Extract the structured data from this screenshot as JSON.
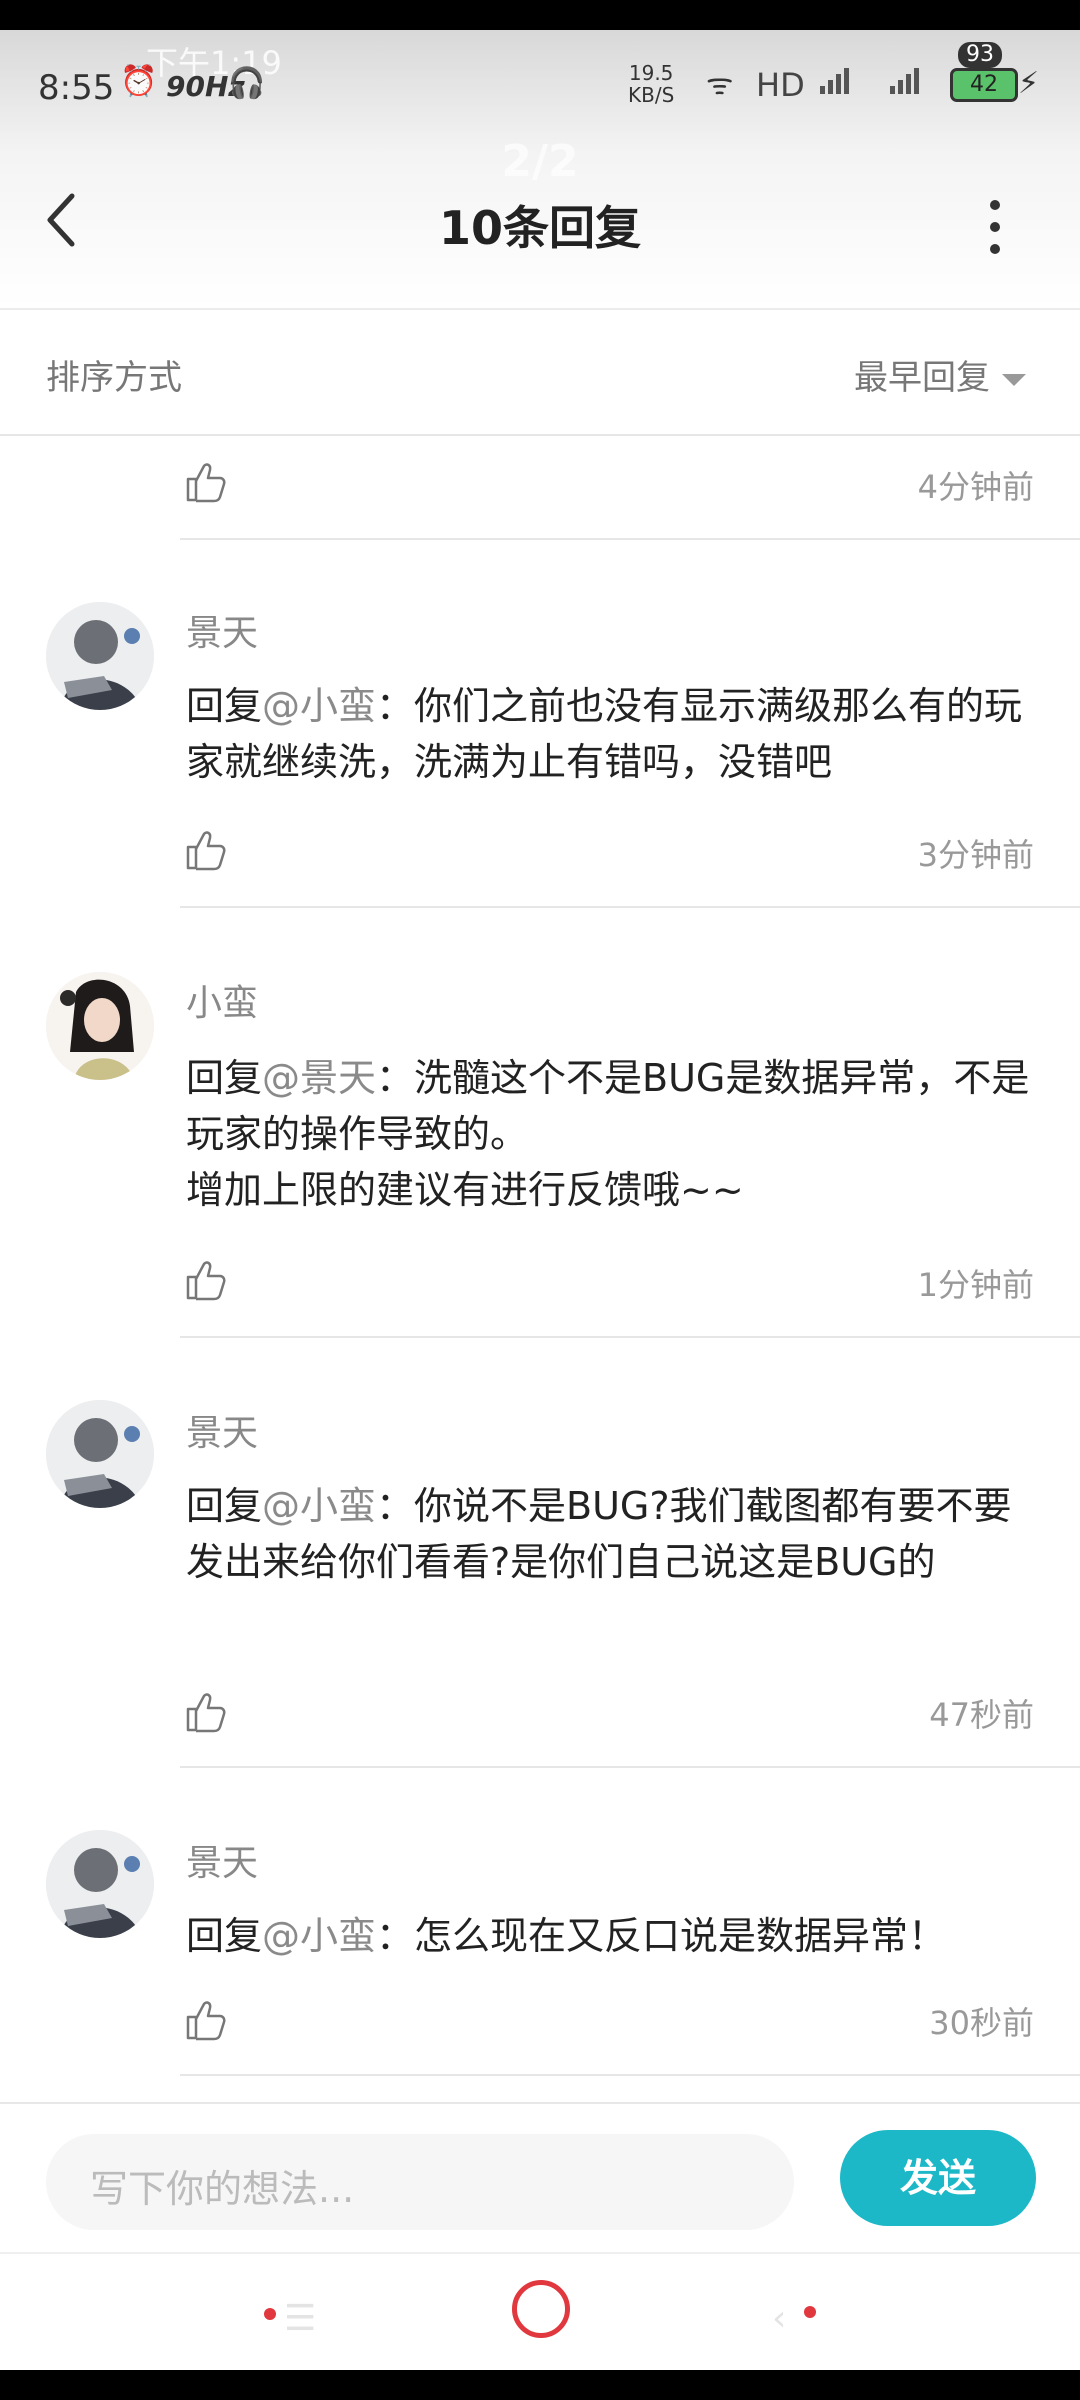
{
  "status_bar": {
    "time": "8:55",
    "refresh_rate": "90Hz",
    "ghost_time": "下午1:19",
    "net_speed": "19.5",
    "net_unit": "KB/S",
    "hd_label": "HD",
    "battery": "42",
    "battery_overlay": "93"
  },
  "header": {
    "title": "10条回复",
    "ghost_title": "2/2"
  },
  "sort": {
    "label": "排序方式",
    "value": "最早回复"
  },
  "prev_item": {
    "time": "4分钟前"
  },
  "replies": [
    {
      "user": "景天",
      "prefix": "回复",
      "mention": "@小蛮",
      "sep": "：",
      "body": "你们之前也没有显示满级那么有的玩家就继续洗，洗满为止有错吗，没错吧",
      "time": "3分钟前"
    },
    {
      "user": "小蛮",
      "prefix": "回复",
      "mention": "@景天",
      "sep": "：",
      "body": "洗髓这个不是BUG是数据异常，不是玩家的操作导致的。\n增加上限的建议有进行反馈哦~~",
      "time": "1分钟前"
    },
    {
      "user": "景天",
      "prefix": "回复",
      "mention": "@小蛮",
      "sep": "：",
      "body": "你说不是BUG?我们截图都有要不要发出来给你们看看?是你们自己说这是BUG的",
      "time": "47秒前"
    },
    {
      "user": "景天",
      "prefix": "回复",
      "mention": "@小蛮",
      "sep": "：",
      "body": "怎么现在又反口说是数据异常！",
      "time": "30秒前"
    }
  ],
  "composer": {
    "placeholder": "写下你的想法...",
    "send_label": "发送"
  },
  "colors": {
    "accent": "#1cb8c8",
    "nav_red": "#e0383e"
  }
}
